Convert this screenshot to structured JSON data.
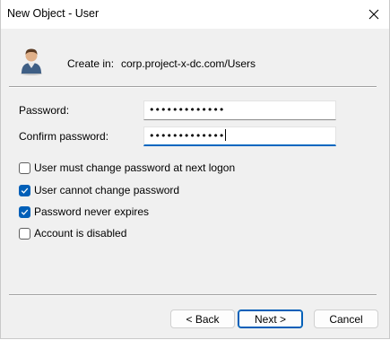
{
  "window": {
    "title": "New Object - User",
    "close_glyph": "close-icon"
  },
  "header": {
    "icon": "user-icon",
    "create_in_label": "Create in:",
    "create_in_path": "corp.project-x-dc.com/Users"
  },
  "form": {
    "password_label": "Password:",
    "password_value": "•••••••••••••",
    "confirm_label": "Confirm password:",
    "confirm_value": "•••••••••••••"
  },
  "options": [
    {
      "label": "User must change password at next logon",
      "checked": false
    },
    {
      "label": "User cannot change password",
      "checked": true
    },
    {
      "label": "Password never expires",
      "checked": true
    },
    {
      "label": "Account is disabled",
      "checked": false
    }
  ],
  "buttons": {
    "back": "< Back",
    "next": "Next >",
    "cancel": "Cancel"
  },
  "colors": {
    "accent": "#005fb8",
    "window_bg": "#f0f0f0",
    "titlebar_bg": "#ffffff"
  }
}
